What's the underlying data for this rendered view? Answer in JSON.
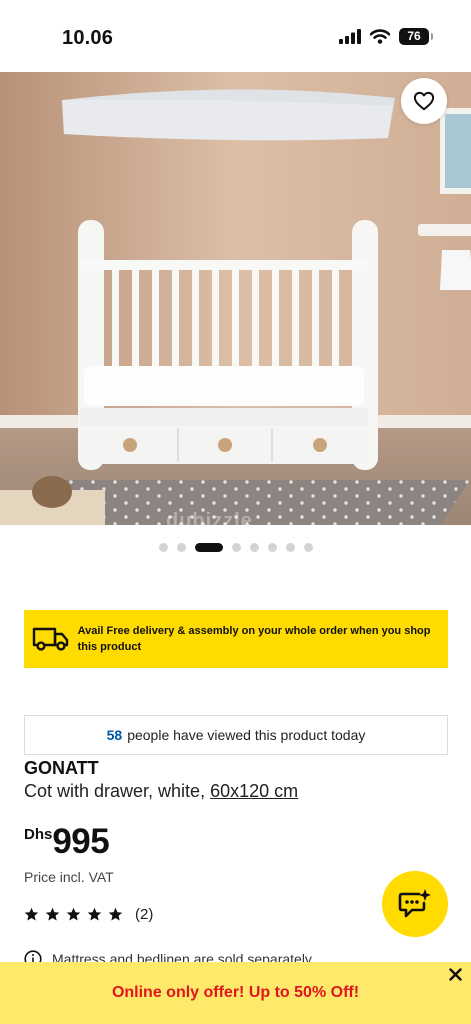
{
  "status_bar": {
    "time": "10.06",
    "battery": "76"
  },
  "hero": {
    "watermark": "dubizzle"
  },
  "carousel": {
    "dot_count": 8,
    "active_index": 2
  },
  "delivery_banner": {
    "text": "Avail Free delivery & assembly on your whole order when you shop this product"
  },
  "viewed": {
    "count": "58",
    "text": "people have viewed this product today"
  },
  "product": {
    "name": "GONATT",
    "description": "Cot with drawer, white,",
    "size": "60x120 cm",
    "currency": "Dhs",
    "price": "995",
    "price_note": "Price incl. VAT",
    "rating_stars": 5,
    "review_count": "(2)"
  },
  "notice": {
    "text": "Mattress and bedlinen are sold separately"
  },
  "promo": {
    "text": "Online only offer! Up to 50% Off!"
  },
  "colors": {
    "brand_yellow": "#ffdb00",
    "promo_red": "#e0161f",
    "link_blue": "#0058a3"
  }
}
